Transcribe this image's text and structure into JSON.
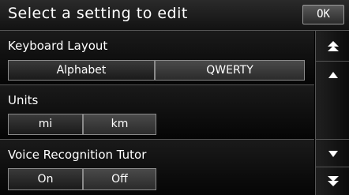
{
  "header": {
    "title": "Select a setting to edit",
    "ok_label": "OK"
  },
  "sections": [
    {
      "label": "Keyboard Layout",
      "options": [
        "Alphabet",
        "QWERTY"
      ],
      "selected": "Alphabet"
    },
    {
      "label": "Units",
      "options": [
        "mi",
        "km"
      ],
      "selected": "mi"
    },
    {
      "label": "Voice Recognition Tutor",
      "options": [
        "On",
        "Off"
      ],
      "selected": "On"
    }
  ],
  "scroll": {
    "icons": [
      "scroll-to-top-icon",
      "scroll-up-icon",
      "scroll-down-icon",
      "scroll-to-bottom-icon"
    ]
  }
}
